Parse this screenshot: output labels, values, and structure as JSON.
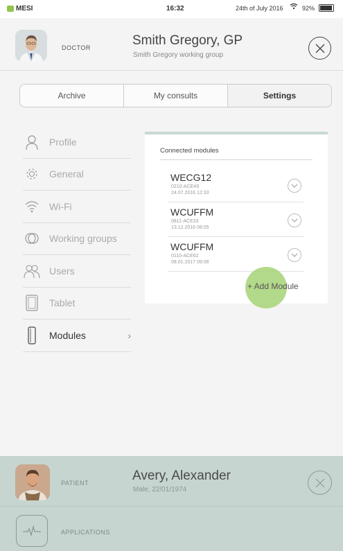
{
  "status_bar": {
    "carrier": "MESI",
    "time": "16:32",
    "date": "24th of July 2016",
    "battery": "92%",
    "battery_level": 0.92
  },
  "doctor": {
    "role": "DOCTOR",
    "name": "Smith Gregory, GP",
    "group": "Smith Gregory working group"
  },
  "tabs": [
    {
      "label": "Archive",
      "active": false
    },
    {
      "label": "My consults",
      "active": false
    },
    {
      "label": "Settings",
      "active": true
    }
  ],
  "menu": [
    {
      "label": "Profile",
      "icon": "person-icon"
    },
    {
      "label": "General",
      "icon": "gear-icon"
    },
    {
      "label": "Wi-Fi",
      "icon": "wifi-icon"
    },
    {
      "label": "Working groups",
      "icon": "groups-icon"
    },
    {
      "label": "Users",
      "icon": "users-icon"
    },
    {
      "label": "Tablet",
      "icon": "tablet-icon"
    },
    {
      "label": "Modules",
      "icon": "module-icon",
      "active": true
    }
  ],
  "modules_panel": {
    "title": "Connected modules",
    "modules": [
      {
        "name": "WECG12",
        "id": "0210-ACE49",
        "date": "24.07.2016   12:33"
      },
      {
        "name": "WCUFFM",
        "id": "0811-ACE33",
        "date": "13.12.2016   08:05"
      },
      {
        "name": "WCUFFM",
        "id": "0110-ACE62",
        "date": "08.01.2017   09:08"
      }
    ],
    "add_label": "+ Add Module"
  },
  "patient": {
    "role": "PATIENT",
    "name": "Avery, Alexander",
    "details": "Male, 22/01/1974"
  },
  "applications": {
    "label": "APPLICATIONS"
  },
  "colors": {
    "accent_green": "#8fc64a",
    "ripple_green": "#a6d276",
    "patient_bar": "#c6d5cf"
  }
}
